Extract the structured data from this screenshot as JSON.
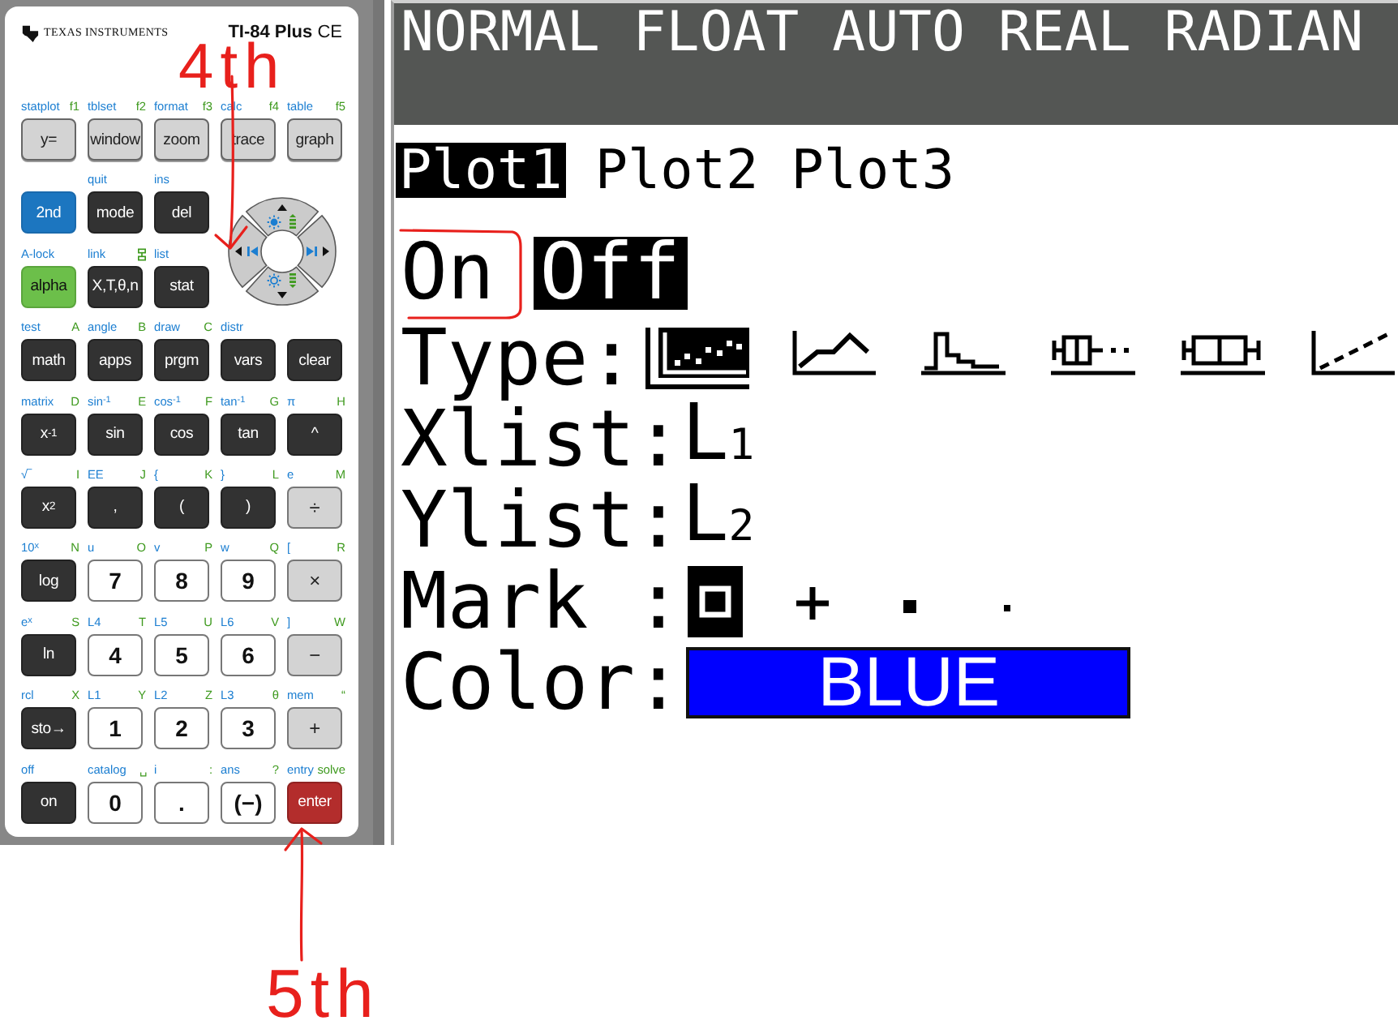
{
  "calculator": {
    "brand": "TEXAS INSTRUMENTS",
    "model": "**TI-84 Plus** CE",
    "keys": [
      {
        "kind": "function",
        "label": "y=",
        "second": "statplot",
        "alpha": "f1"
      },
      {
        "kind": "function",
        "label": "window",
        "second": "tblset",
        "alpha": "f2"
      },
      {
        "kind": "function",
        "label": "zoom",
        "second": "format",
        "alpha": "f3"
      },
      {
        "kind": "function",
        "label": "trace",
        "second": "calc",
        "alpha": "f4"
      },
      {
        "kind": "function",
        "label": "graph",
        "second": "table",
        "alpha": "f5"
      },
      {
        "kind": "second",
        "label": "2nd"
      },
      {
        "kind": "dark",
        "label": "mode",
        "second": "quit"
      },
      {
        "kind": "dark",
        "label": "del",
        "second": "ins"
      },
      {
        "kind": "alpha",
        "label": "alpha",
        "second": "A-lock"
      },
      {
        "kind": "dark",
        "label": "X,T,θ,n",
        "second": "link",
        "alpha_icon": true
      },
      {
        "kind": "dark",
        "label": "stat",
        "second": "list"
      },
      {
        "kind": "dark",
        "label": "math",
        "second": "test",
        "alpha": "A"
      },
      {
        "kind": "dark",
        "label": "apps",
        "second": "angle",
        "alpha": "B"
      },
      {
        "kind": "dark",
        "label": "prgm",
        "second": "draw",
        "alpha": "C"
      },
      {
        "kind": "dark",
        "label": "vars",
        "second": "distr"
      },
      {
        "kind": "dark",
        "label": "clear"
      },
      {
        "kind": "dark",
        "label": "x$^{-1}$",
        "second": "matrix",
        "alpha": "D"
      },
      {
        "kind": "dark",
        "label": "sin",
        "second": "sin$^{-1}$",
        "alpha": "E"
      },
      {
        "kind": "dark",
        "label": "cos",
        "second": "cos$^{-1}$",
        "alpha": "F"
      },
      {
        "kind": "dark",
        "label": "tan",
        "second": "tan$^{-1}$",
        "alpha": "G"
      },
      {
        "kind": "dark",
        "label": "^",
        "second": "π",
        "alpha": "H"
      },
      {
        "kind": "dark",
        "label": "x$^{2}$",
        "second": "√‾",
        "alpha": "I"
      },
      {
        "kind": "dark",
        "label": ",",
        "second": "EE",
        "alpha": "J"
      },
      {
        "kind": "dark",
        "label": "(",
        "second": "{",
        "alpha": "K"
      },
      {
        "kind": "dark",
        "label": ")",
        "second": "}",
        "alpha": "L"
      },
      {
        "kind": "operator",
        "label": "÷",
        "second": "e",
        "alpha": "M"
      },
      {
        "kind": "dark",
        "label": "log",
        "second": "10$^{x}$",
        "alpha": "N"
      },
      {
        "kind": "number",
        "label": "7",
        "second": "u",
        "alpha": "O"
      },
      {
        "kind": "number",
        "label": "8",
        "second": "v",
        "alpha": "P"
      },
      {
        "kind": "number",
        "label": "9",
        "second": "w",
        "alpha": "Q"
      },
      {
        "kind": "operator",
        "label": "×",
        "second": "[",
        "alpha": "R"
      },
      {
        "kind": "dark",
        "label": "ln",
        "second": "e$^{x}$",
        "alpha": "S"
      },
      {
        "kind": "number",
        "label": "4",
        "second": "L4",
        "alpha": "T"
      },
      {
        "kind": "number",
        "label": "5",
        "second": "L5",
        "alpha": "U"
      },
      {
        "kind": "number",
        "label": "6",
        "second": "L6",
        "alpha": "V"
      },
      {
        "kind": "operator",
        "label": "−",
        "second": "]",
        "alpha": "W"
      },
      {
        "kind": "dark",
        "label": "sto→",
        "second": "rcl",
        "alpha": "X"
      },
      {
        "kind": "number",
        "label": "1",
        "second": "L1",
        "alpha": "Y"
      },
      {
        "kind": "number",
        "label": "2",
        "second": "L2",
        "alpha": "Z"
      },
      {
        "kind": "number",
        "label": "3",
        "second": "L3",
        "alpha": "θ"
      },
      {
        "kind": "operator",
        "label": "+",
        "second": "mem",
        "alpha": "“"
      },
      {
        "kind": "dark",
        "label": "on",
        "second": "off"
      },
      {
        "kind": "number",
        "label": "0",
        "second": "catalog",
        "alpha": "␣"
      },
      {
        "kind": "number",
        "label": ".",
        "second": "i",
        "alpha": ":"
      },
      {
        "kind": "number",
        "label": "(−)",
        "second": "ans",
        "alpha": "?"
      },
      {
        "kind": "enter",
        "label": "enter",
        "second": "entry",
        "alpha": "solve"
      }
    ]
  },
  "screen": {
    "status": "NORMAL FLOAT AUTO REAL RADIAN",
    "plots": [
      {
        "label": "Plot1",
        "selected": true
      },
      {
        "label": "Plot2",
        "selected": false
      },
      {
        "label": "Plot3",
        "selected": false
      }
    ],
    "states": [
      {
        "label": "On",
        "selected": false,
        "circled": true
      },
      {
        "label": "Off",
        "selected": true,
        "circled": false
      }
    ],
    "type": {
      "label": "Type:",
      "options": [
        {
          "kind": "scatter",
          "selected": true
        },
        {
          "kind": "xyline",
          "selected": false
        },
        {
          "kind": "histogram",
          "selected": false
        },
        {
          "kind": "modbox",
          "selected": false
        },
        {
          "kind": "box",
          "selected": false
        },
        {
          "kind": "normprob",
          "selected": false
        }
      ]
    },
    "xlist": {
      "label": "Xlist:",
      "value": "L$_{1}$"
    },
    "ylist": {
      "label": "Ylist:",
      "value": "L$_{2}$"
    },
    "mark": {
      "label": "Mark :",
      "options": [
        {
          "kind": "box",
          "selected": true
        },
        {
          "kind": "cross",
          "selected": false
        },
        {
          "kind": "square",
          "selected": false
        },
        {
          "kind": "dot",
          "selected": false
        }
      ]
    },
    "color": {
      "label": "Color:",
      "value": "BLUE",
      "color": "#0000ff"
    }
  },
  "annotations": [
    {
      "text": "4th"
    },
    {
      "text": "5th"
    }
  ]
}
